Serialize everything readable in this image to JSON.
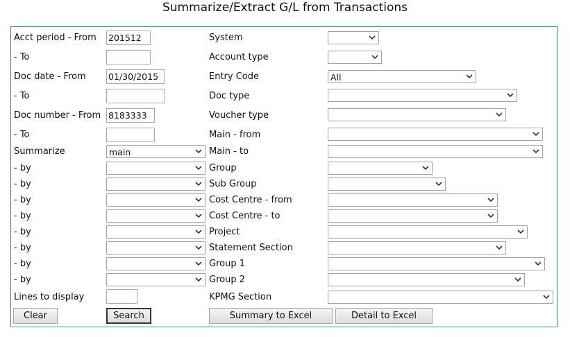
{
  "title": "Summarize/Extract G/L from Transactions",
  "left": {
    "acct_from_label": "Acct period - From",
    "acct_from_value": "201512",
    "acct_to_label": "- To",
    "acct_to_value": "",
    "docdate_from_label": "Doc date - From",
    "docdate_from_value": "01/30/2015",
    "docdate_to_label": "- To",
    "docdate_to_value": "",
    "docnum_from_label": "Doc number - From",
    "docnum_from_value": "8183333",
    "docnum_to_label": "- To",
    "docnum_to_value": "",
    "summarize_label": "Summarize",
    "summarize_value": "main",
    "by_labels": [
      "- by",
      "- by",
      "- by",
      "- by",
      "- by",
      "- by",
      "- by",
      "- by"
    ],
    "lines_label": "Lines to display",
    "lines_value": ""
  },
  "right": {
    "system": "System",
    "account_type": "Account type",
    "entry_code": "Entry Code",
    "entry_code_value": "All",
    "doc_type": "Doc type",
    "voucher_type": "Voucher type",
    "main_from": "Main - from",
    "main_to": "Main - to",
    "group": "Group",
    "sub_group": "Sub Group",
    "cost_centre_from": "Cost Centre - from",
    "cost_centre_to": "Cost Centre - to",
    "project": "Project",
    "statement_section": "Statement Section",
    "group1": "Group 1",
    "group2": "Group 2",
    "kpmg_section": "KPMG Section"
  },
  "buttons": {
    "clear": "Clear",
    "search": "Search",
    "summary_excel": "Summary to Excel",
    "detail_excel": "Detail to Excel"
  }
}
